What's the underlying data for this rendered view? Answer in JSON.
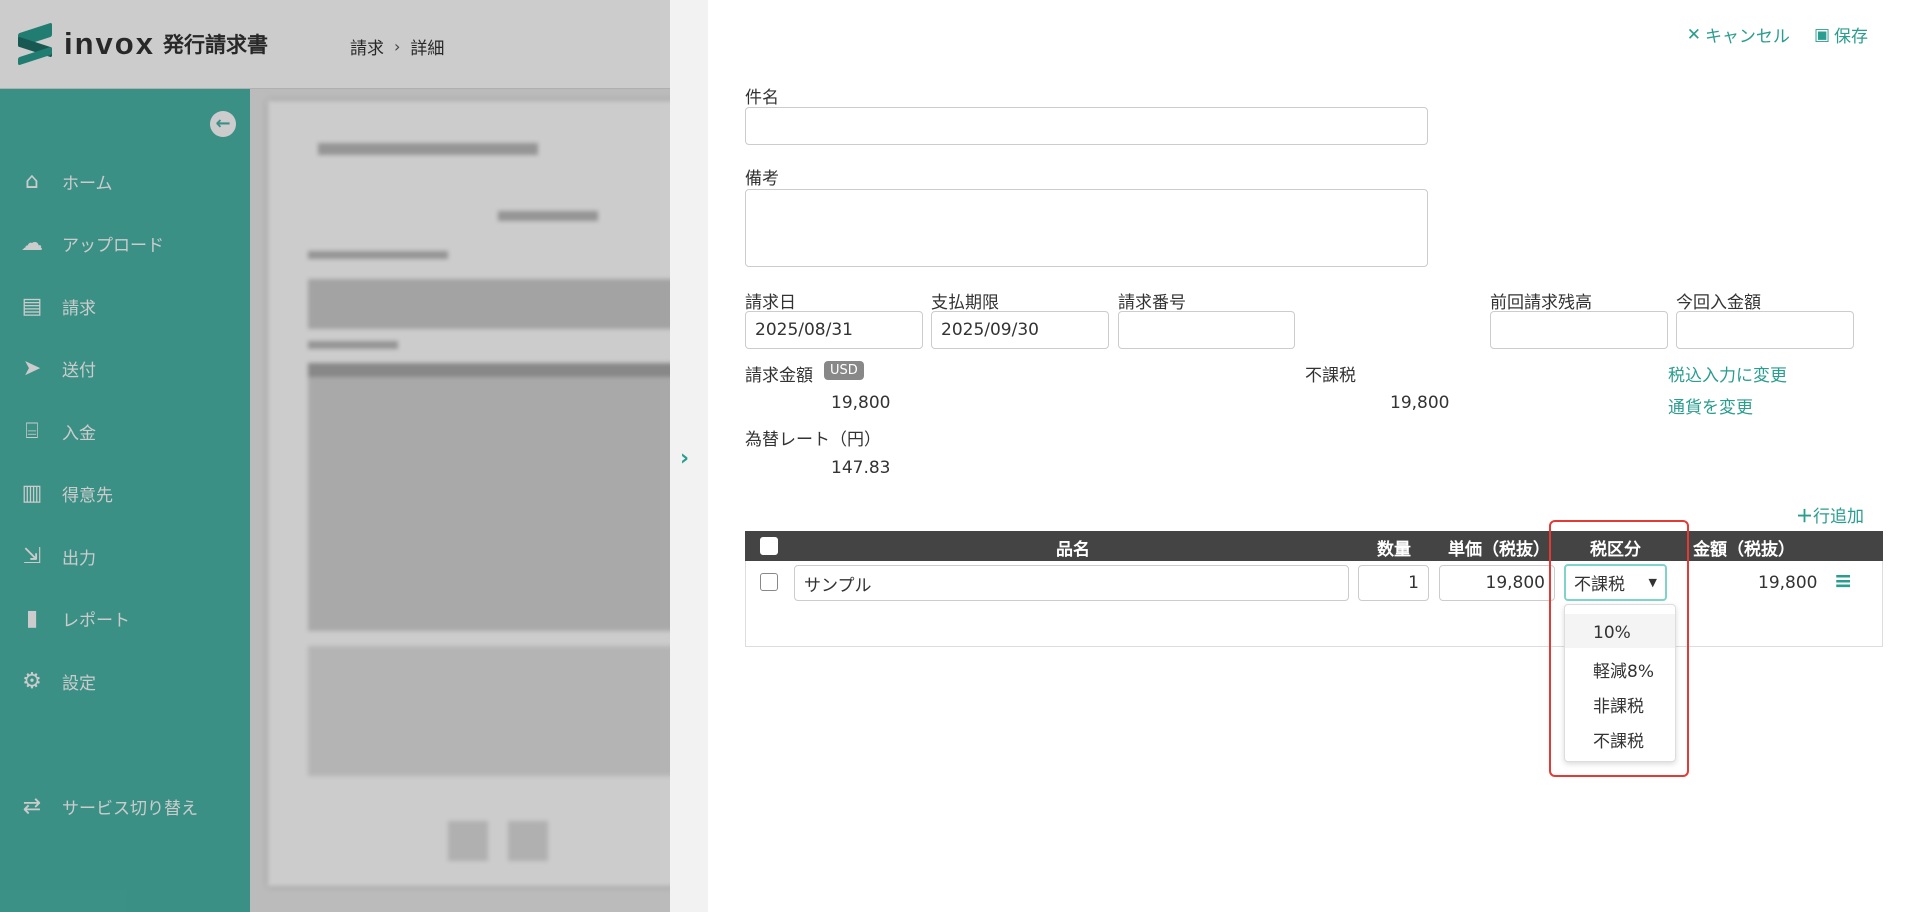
{
  "header": {
    "logo_text": "invox",
    "logo_sub": "発行請求書",
    "breadcrumb": [
      "請求",
      "詳細"
    ]
  },
  "sidebar": {
    "collapse_icon": "arrow-left-circle-icon",
    "items": [
      {
        "label": "ホーム",
        "icon": "home-icon"
      },
      {
        "label": "アップロード",
        "icon": "cloud-upload-icon"
      },
      {
        "label": "請求",
        "icon": "document-icon"
      },
      {
        "label": "送付",
        "icon": "paper-plane-icon"
      },
      {
        "label": "入金",
        "icon": "bank-icon"
      },
      {
        "label": "得意先",
        "icon": "building-icon"
      },
      {
        "label": "出力",
        "icon": "file-export-icon"
      },
      {
        "label": "レポート",
        "icon": "chart-icon"
      },
      {
        "label": "設定",
        "icon": "gear-icon"
      },
      {
        "label": "サービス切り替え",
        "icon": "switch-icon"
      }
    ]
  },
  "panel": {
    "cancel_label": "キャンセル",
    "save_label": "保存",
    "subject_label": "件名",
    "subject_value": "",
    "notes_label": "備考",
    "notes_value": "",
    "invoice_date_label": "請求日",
    "invoice_date_value": "2025/08/31",
    "due_date_label": "支払期限",
    "due_date_value": "2025/09/30",
    "invoice_number_label": "請求番号",
    "invoice_number_value": "",
    "prev_balance_label": "前回請求残高",
    "prev_balance_value": "",
    "this_payment_label": "今回入金額",
    "this_payment_value": "",
    "amount_label": "請求金額",
    "currency_badge": "USD",
    "amount_value": "19,800",
    "tax_type_label": "不課税",
    "tax_type_value": "19,800",
    "tax_incl_link": "税込入力に変更",
    "currency_link": "通貨を変更",
    "rate_label": "為替レート（円）",
    "rate_value": "147.83",
    "add_row_label": "行追加"
  },
  "table": {
    "headers": {
      "item": "品名",
      "qty": "数量",
      "unit_price": "単価（税抜）",
      "tax_class": "税区分",
      "amount": "金額（税抜）"
    },
    "rows": [
      {
        "item": "サンプル",
        "qty": "1",
        "unit_price": "19,800",
        "tax_class": "不課税",
        "amount": "19,800"
      }
    ]
  },
  "tax_dropdown": {
    "selected": "不課税",
    "options": [
      "10%",
      "軽減8%",
      "非課税",
      "不課税"
    ],
    "highlighted_index": 0
  }
}
